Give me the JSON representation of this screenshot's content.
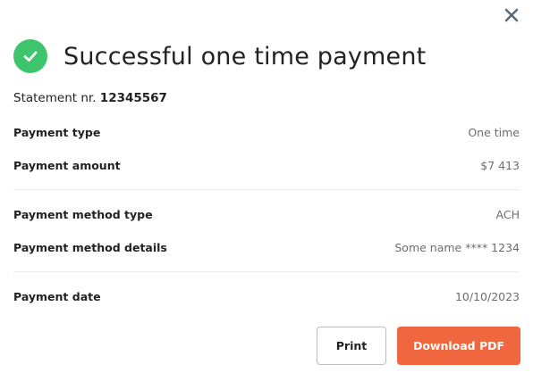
{
  "dialog": {
    "title": "Successful one time payment",
    "statement_label": "Statement nr.",
    "statement_number": "12345567"
  },
  "details": {
    "payment_type": {
      "label": "Payment type",
      "value": "One time"
    },
    "payment_amount": {
      "label": "Payment amount",
      "value": "$7 413"
    },
    "method_type": {
      "label": "Payment method type",
      "value": "ACH"
    },
    "method_details": {
      "label": "Payment method details",
      "value": "Some name **** 1234"
    },
    "payment_date": {
      "label": "Payment date",
      "value": "10/10/2023"
    }
  },
  "actions": {
    "print_label": "Print",
    "download_label": "Download PDF"
  },
  "colors": {
    "success": "#3ec46d",
    "accent": "#f0663f"
  },
  "icons": {
    "close": "close-icon",
    "success": "checkmark-icon"
  }
}
